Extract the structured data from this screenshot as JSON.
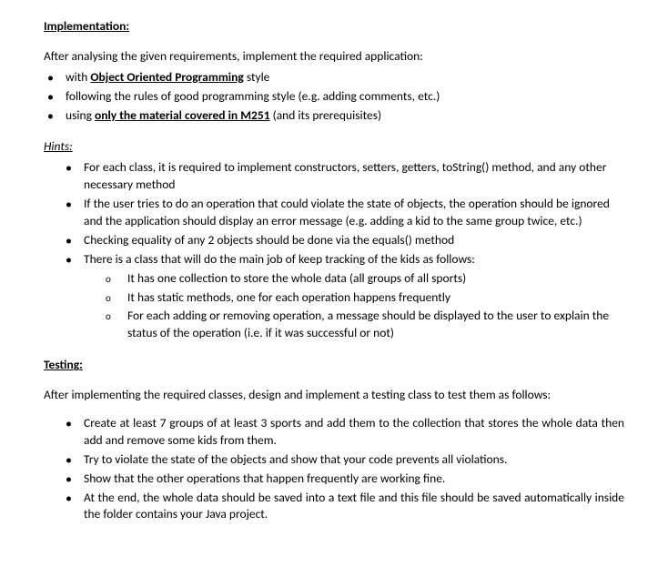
{
  "implementation": {
    "heading": "Implementation:",
    "intro": "After analysing the given requirements, implement the required application:",
    "items": [
      {
        "prefix": "with ",
        "bold": "Object Oriented Programming",
        "suffix": " style"
      },
      {
        "text": "following the rules of good programming style (e.g. adding comments, etc.)"
      },
      {
        "prefix": "using ",
        "bold": "only the material covered in M251",
        "suffix": " (and its prerequisites)"
      }
    ]
  },
  "hints": {
    "heading": "Hints:",
    "items": [
      "For each class, it is required to implement constructors, setters, getters, toString() method, and any other necessary method",
      "If the user tries to do an operation that could violate the state of objects, the operation should be ignored and the application should display an error message (e.g. adding a kid to the same group twice, etc.)",
      "Checking equality of any 2 objects should be done via the equals() method",
      "There is a class that will do the main job of keep tracking of the kids as follows:"
    ],
    "subitems": [
      "It has one collection to store the whole data (all groups of all sports)",
      "It has static methods, one for each operation happens frequently",
      "For each adding or removing operation, a message should be displayed to the user to explain the status of the operation (i.e. if it was successful or not)"
    ]
  },
  "testing": {
    "heading": "Testing:",
    "intro": "After implementing the required classes, design and implement a testing class to test them as follows:",
    "items": [
      "Create at least 7 groups of at least 3 sports and add them to the collection that stores the whole data then add and remove some kids from them.",
      "Try to violate the state of the objects and show that your code prevents all violations.",
      "Show that the other operations that happen frequently are working fine.",
      "At the end, the whole data should be saved into a text file and this file should be saved automatically inside the folder contains your Java project."
    ]
  }
}
